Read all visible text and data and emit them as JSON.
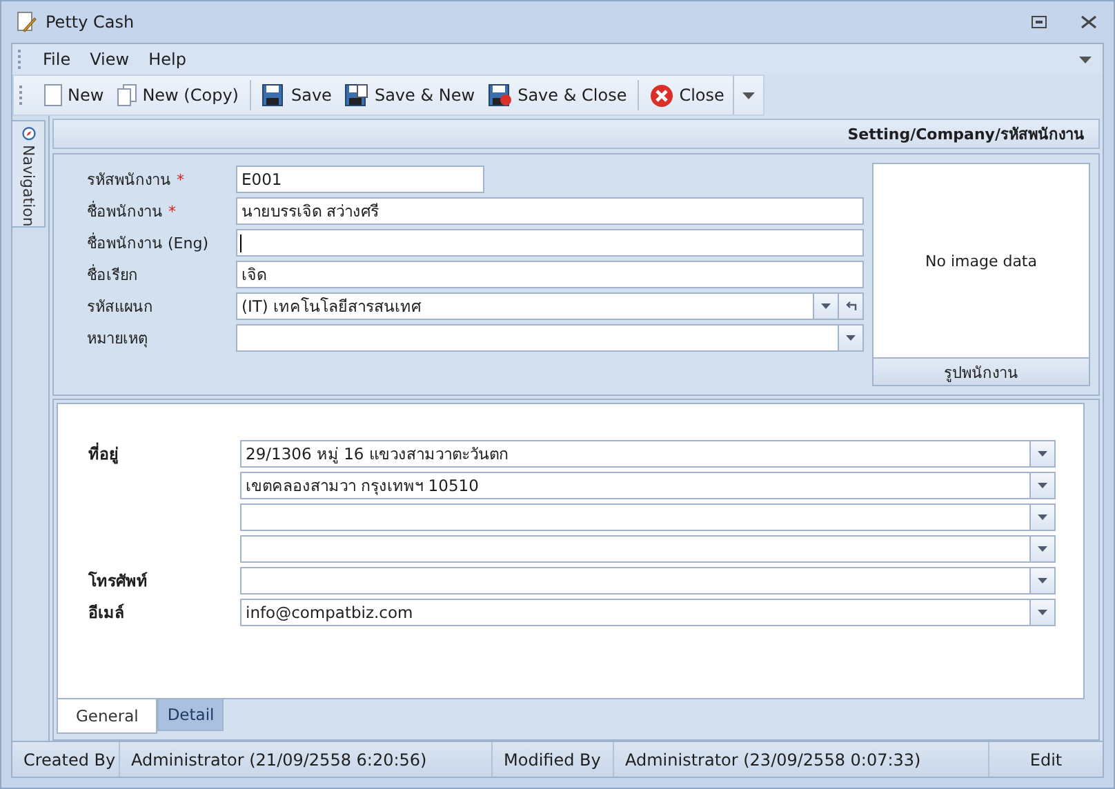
{
  "window": {
    "title": "Petty Cash"
  },
  "menu": [
    "File",
    "View",
    "Help"
  ],
  "toolbar": [
    [
      {
        "label": "New"
      },
      {
        "label": "New (Copy)"
      }
    ],
    [
      {
        "label": "Save"
      },
      {
        "label": "Save & New"
      },
      {
        "label": "Save & Close"
      }
    ],
    [
      {
        "label": "Close"
      }
    ]
  ],
  "navigation": {
    "label": "Navigation"
  },
  "breadcrumb": "Setting/Company/รหัสพนักงาน",
  "fields": [
    {
      "label": "รหัสพนักงาน",
      "required_mark": "*",
      "value": "E001",
      "kind": "short",
      "focused": false
    },
    {
      "label": "ชื่อพนักงาน",
      "required_mark": "*",
      "value": "นายบรรเจิด สว่างศรี",
      "kind": "text",
      "focused": false
    },
    {
      "label": "ชื่อพนักงาน (Eng)",
      "kind": "text",
      "focused": true
    },
    {
      "label": "ชื่อเรียก",
      "value": "เจิด",
      "kind": "text",
      "focused": false
    },
    {
      "label": "รหัสแผนก",
      "value": "(IT) เทคโนโลยีสารสนเทศ",
      "kind": "lookup",
      "focused": false
    },
    {
      "label": "หมายเหตุ",
      "kind": "combo",
      "focused": false
    }
  ],
  "photo": {
    "placeholder": "No image data",
    "caption": "รูปพนักงาน"
  },
  "contact": [
    {
      "kind": "combo",
      "label": "ที่อยู่",
      "value": "29/1306 หมู่ 16 แขวงสามวาตะวันตก"
    },
    {
      "kind": "combo",
      "value": "เขตคลองสามวา กรุงเทพฯ 10510"
    },
    {
      "kind": "combo"
    },
    {
      "kind": "combo"
    },
    {
      "kind": "combo",
      "label": "โทรศัพท์"
    },
    {
      "kind": "combo",
      "label": "อีเมล์",
      "value": "info@compatbiz.com"
    }
  ],
  "tabs": [
    {
      "label": "General",
      "selected": true
    },
    {
      "label": "Detail",
      "selected": false
    }
  ],
  "status_bar": {
    "created_label": "Created By",
    "created": "Administrator (21/09/2558 6:20:56)",
    "modified_label": "Modified By",
    "modified": "Administrator (23/09/2558 0:07:33)",
    "mode": "Edit"
  }
}
